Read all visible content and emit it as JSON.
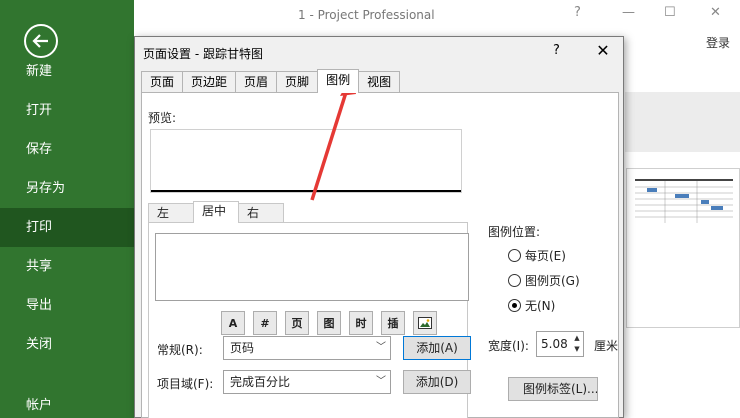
{
  "app": {
    "title": "1 - Project Professional",
    "help_glyph": "?",
    "signin": "登录"
  },
  "backstage": {
    "nav": [
      "新建",
      "打开",
      "保存",
      "另存为",
      "打印",
      "共享",
      "导出",
      "关闭",
      "帐户"
    ],
    "active": "打印"
  },
  "dialog": {
    "title": "页面设置 - 跟踪甘特图",
    "help": "?",
    "close": "✕",
    "tabs": [
      "页面",
      "页边距",
      "页眉",
      "页脚",
      "图例",
      "视图"
    ],
    "active_tab": "图例",
    "preview_label": "预览:",
    "subtabs": [
      "左",
      "居中",
      "右"
    ],
    "active_subtab": "居中",
    "format_buttons": [
      "A",
      "#",
      "页",
      "图",
      "时",
      "插",
      "图片"
    ],
    "general_label": "常规(R):",
    "general_value": "页码",
    "add1": "添加(A)",
    "field_label": "项目域(F):",
    "field_value": "完成百分比",
    "add2": "添加(D)",
    "legend_pos_label": "图例位置:",
    "radio_every_page": "每页(E)",
    "radio_legend_page": "图例页(G)",
    "radio_none": "无(N)",
    "selected_radio": "无(N)",
    "width_label": "宽度(I):",
    "width_value": "5.08",
    "width_unit": "厘米",
    "legend_labels_btn": "图例标签(L)..."
  },
  "colors": {
    "sidebar": "#31752f",
    "sidebar_active": "#20561f",
    "arrow": "#e53935"
  }
}
